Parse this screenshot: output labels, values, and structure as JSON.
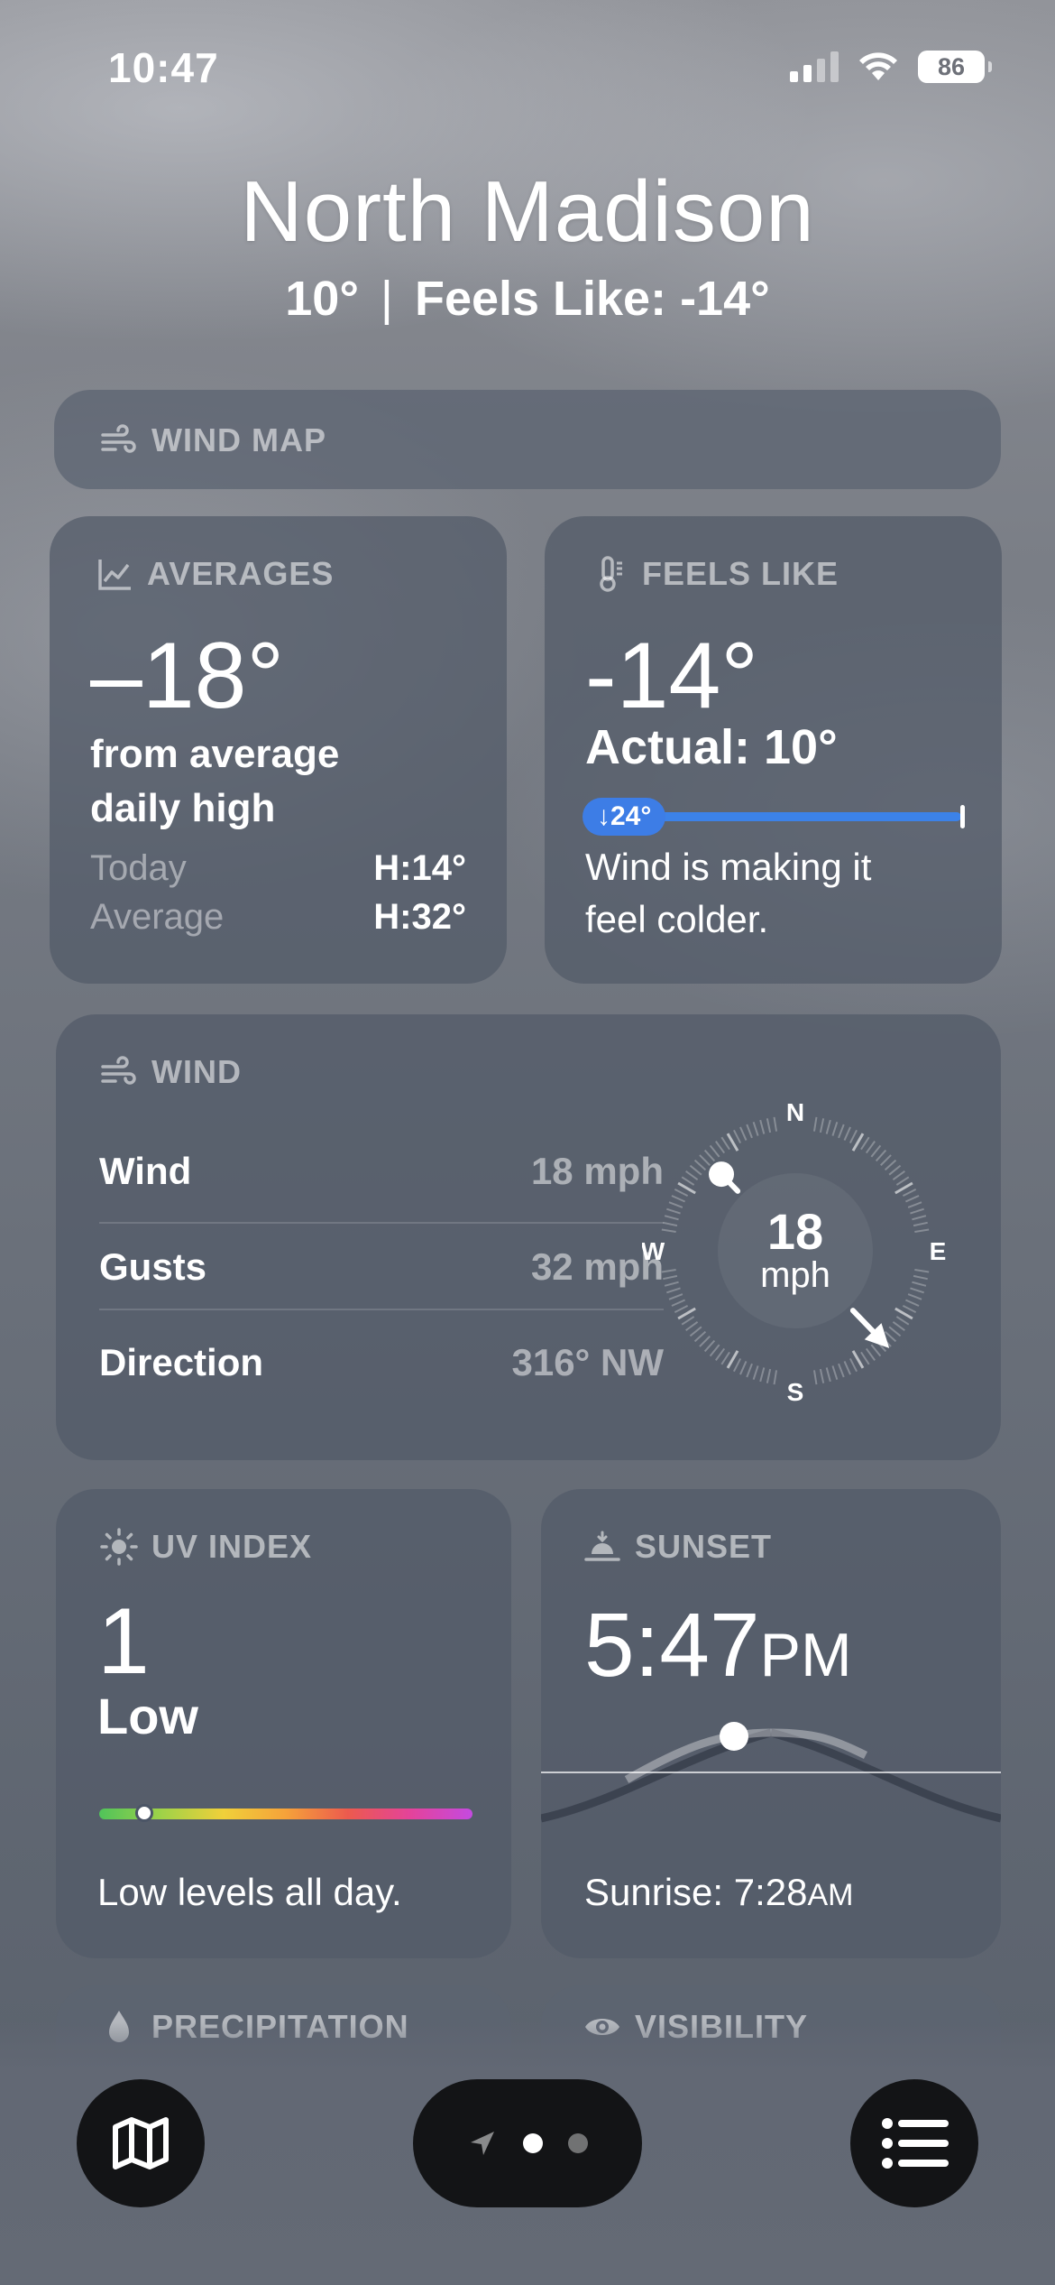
{
  "status_bar": {
    "time": "10:47",
    "battery": "86"
  },
  "header": {
    "location": "North Madison",
    "temp": "10°",
    "separator": "|",
    "feels_like": "Feels Like: -14°"
  },
  "wind_map": {
    "title": "WIND MAP"
  },
  "averages": {
    "title": "AVERAGES",
    "value": "–18°",
    "caption_line1": "from average",
    "caption_line2": "daily high",
    "today_label": "Today",
    "today_value": "H:14°",
    "average_label": "Average",
    "average_value": "H:32°"
  },
  "feels_like": {
    "title": "FEELS LIKE",
    "value": "-14°",
    "actual": "Actual: 10°",
    "diff_badge": "↓24°",
    "description_line1": "Wind is making it",
    "description_line2": "feel colder."
  },
  "wind": {
    "title": "WIND",
    "rows": [
      {
        "label": "Wind",
        "value": "18 mph"
      },
      {
        "label": "Gusts",
        "value": "32 mph"
      },
      {
        "label": "Direction",
        "value": "316° NW"
      }
    ],
    "compass": {
      "speed": "18",
      "unit": "mph",
      "n": "N",
      "e": "E",
      "s": "S",
      "w": "W",
      "direction_deg": 316
    }
  },
  "uv_index": {
    "title": "UV INDEX",
    "value": "1",
    "level": "Low",
    "description": "Low levels all day.",
    "scale_level": 1
  },
  "sunset": {
    "title": "SUNSET",
    "time": "5:47",
    "ampm": "PM",
    "sunrise_label": "Sunrise: 7:28",
    "sunrise_ampm": "AM"
  },
  "peek_cards": {
    "left_title": "PRECIPITATION",
    "right_title": "VISIBILITY"
  },
  "colors": {
    "accent_blue": "#3d7de6",
    "card_bg": "#525a68"
  },
  "icons": [
    "map-icon",
    "location-arrow-icon",
    "list-icon",
    "wind-icon",
    "chart-icon",
    "thermometer-icon",
    "sun-icon",
    "sunset-icon",
    "drop-icon",
    "eye-icon"
  ]
}
